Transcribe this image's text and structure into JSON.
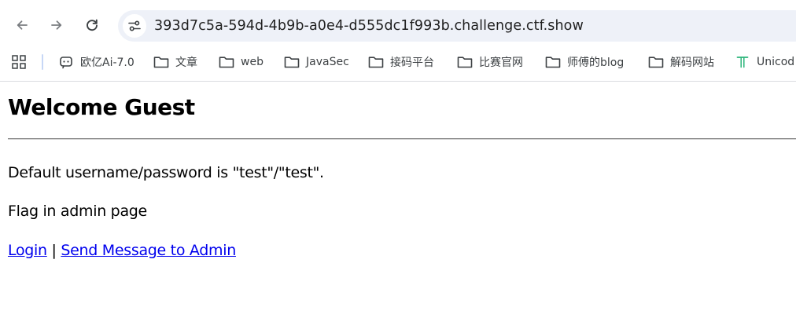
{
  "browser": {
    "url": "393d7c5a-594d-4b9b-a0e4-d555dc1f993b.challenge.ctf.show",
    "nav": {
      "back_icon": "arrow-left-icon",
      "forward_icon": "arrow-right-icon",
      "reload_icon": "reload-icon",
      "site_info_icon": "tune-icon"
    },
    "bookmarks": [
      {
        "label": "欧亿Ai-7.0",
        "icon": "chat-bot-icon"
      },
      {
        "label": "文章",
        "icon": "folder-icon"
      },
      {
        "label": "web",
        "icon": "folder-icon"
      },
      {
        "label": "JavaSec",
        "icon": "folder-icon"
      },
      {
        "label": "接码平台",
        "icon": "folder-icon"
      },
      {
        "label": "比赛官网",
        "icon": "folder-icon"
      },
      {
        "label": "师傅的blog",
        "icon": "folder-icon"
      },
      {
        "label": "解码网站",
        "icon": "folder-icon"
      },
      {
        "label": "Unicod",
        "icon": "unicode-t-icon"
      }
    ]
  },
  "page": {
    "heading": "Welcome Guest",
    "default_credentials": "Default username/password is \"test\"/\"test\".",
    "flag_hint": "Flag in admin page",
    "links": {
      "login": "Login",
      "separator": "|",
      "send_message": "Send Message to Admin"
    }
  }
}
